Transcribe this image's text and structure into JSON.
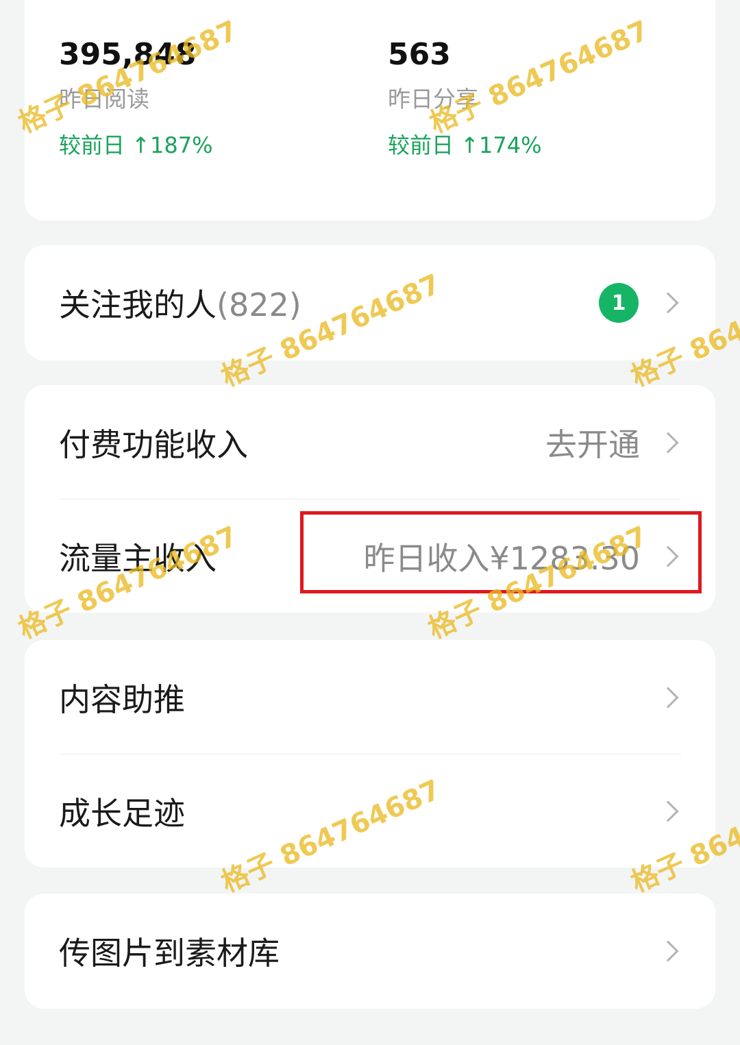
{
  "stats": {
    "reads": {
      "value": "395,848",
      "label": "昨日阅读",
      "change": "较前日 ↑187%"
    },
    "shares": {
      "value": "563",
      "label": "昨日分享",
      "change": "较前日 ↑174%"
    }
  },
  "followers": {
    "label": "关注我的人",
    "count": "(822)",
    "badge": "1"
  },
  "paid_income": {
    "label": "付费功能收入",
    "action": "去开通"
  },
  "traffic_income": {
    "label": "流量主收入",
    "value": "昨日收入¥1283.30"
  },
  "content_boost": {
    "label": "内容助推"
  },
  "growth": {
    "label": "成长足迹"
  },
  "upload": {
    "label": "传图片到素材库"
  },
  "watermark_text": "格子 864764687",
  "colors": {
    "accent_green": "#1aa35c",
    "badge_green": "#15b565",
    "highlight_red": "#e0181e",
    "watermark_yellow": "#e9ba24"
  }
}
